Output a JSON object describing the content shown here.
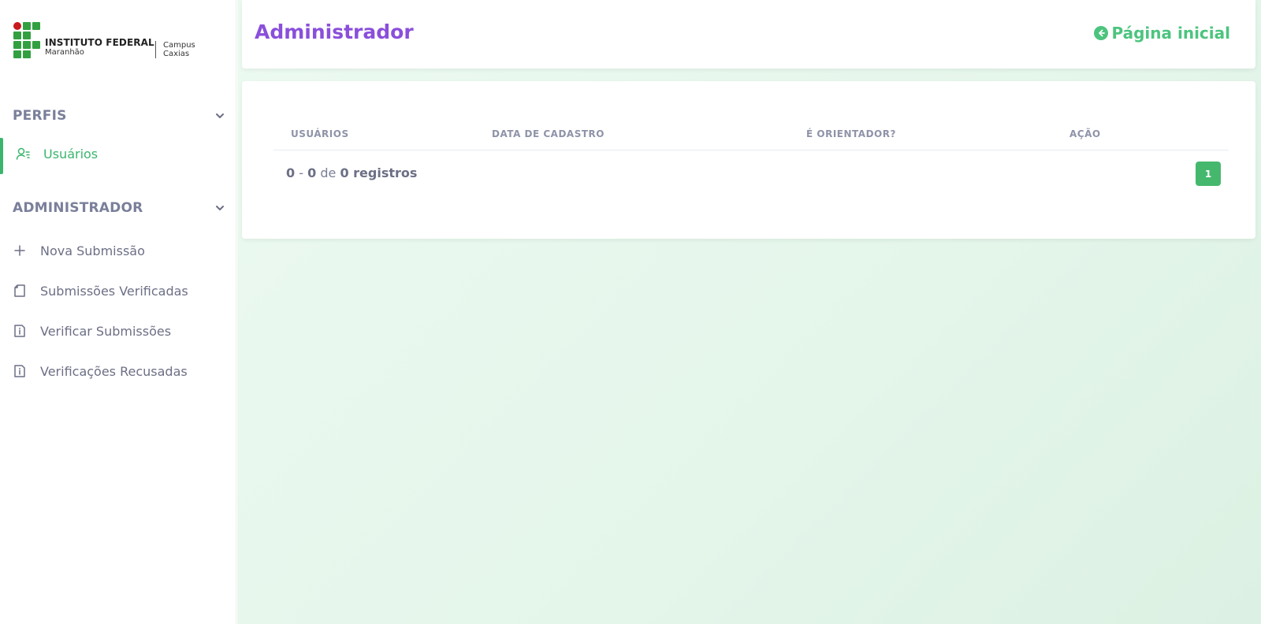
{
  "logo": {
    "main": "INSTITUTO FEDERAL",
    "sub": "Maranhão",
    "campus_line1": "Campus",
    "campus_line2": "Caxias"
  },
  "sidebar": {
    "sections": [
      {
        "title": "PERFIS",
        "items": [
          {
            "label": "Usuários",
            "icon": "user-list-icon",
            "active": true
          }
        ]
      },
      {
        "title": "ADMINISTRADOR",
        "items": [
          {
            "label": "Nova Submissão",
            "icon": "plus-icon"
          },
          {
            "label": "Submissões Verificadas",
            "icon": "document-icon"
          },
          {
            "label": "Verificar Submissões",
            "icon": "document-info-icon"
          },
          {
            "label": "Verificações Recusadas",
            "icon": "document-info-icon"
          }
        ]
      }
    ]
  },
  "header": {
    "title": "Administrador",
    "home_link": "Página inicial"
  },
  "table": {
    "columns": [
      "USUÁRIOS",
      "DATA DE CADASTRO",
      "É ORIENTADOR?",
      "AÇÃO"
    ],
    "count_from": "0",
    "count_to": "0",
    "count_sep": "-",
    "count_of": "de",
    "count_total": "0 registros",
    "page": "1"
  },
  "colors": {
    "accent_green": "#3bb56d",
    "title_purple": "#8a4fdb",
    "muted_text": "#6c6f85"
  }
}
